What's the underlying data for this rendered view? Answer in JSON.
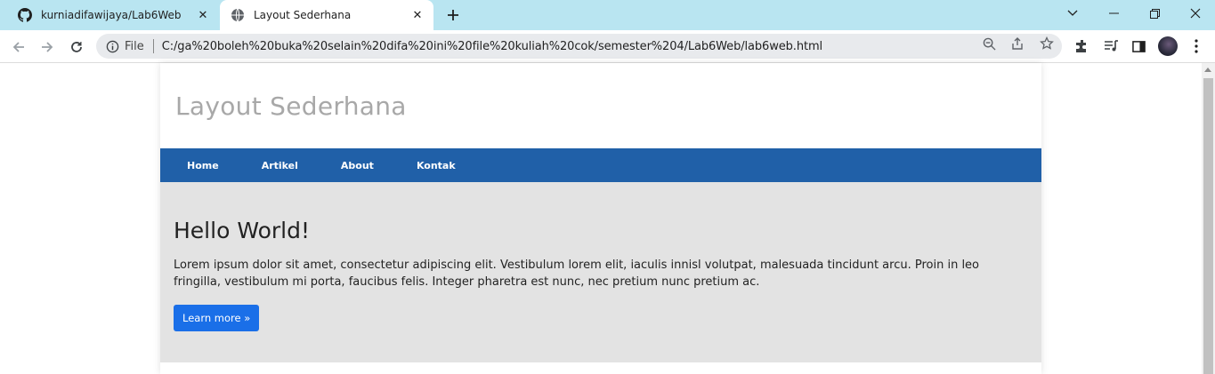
{
  "browser": {
    "tabs": [
      {
        "title": "kurniadifawijaya/Lab6Web",
        "icon": "github-icon"
      },
      {
        "title": "Layout Sederhana",
        "icon": "globe-icon"
      }
    ],
    "omnibox": {
      "scheme_label": "File",
      "url": "C:/ga%20boleh%20buka%20selain%20difa%20ini%20file%20kuliah%20cok/semester%204/Lab6Web/lab6web.html"
    }
  },
  "page": {
    "header_title": "Layout Sederhana",
    "nav": [
      "Home",
      "Artikel",
      "About",
      "Kontak"
    ],
    "hero": {
      "heading": "Hello World!",
      "text": "Lorem ipsum dolor sit amet, consectetur adipiscing elit. Vestibulum lorem elit, iaculis innisl volutpat, malesuada tincidunt arcu. Proin in leo fringilla, vestibulum mi porta, faucibus felis. Integer pharetra est nunc, nec pretium nunc pretium ac.",
      "button": "Learn more »"
    }
  },
  "colors": {
    "tabbar": "#b9e5f1",
    "nav": "#2060a8",
    "hero_bg": "#e3e3e3",
    "button": "#1a6fe8"
  }
}
